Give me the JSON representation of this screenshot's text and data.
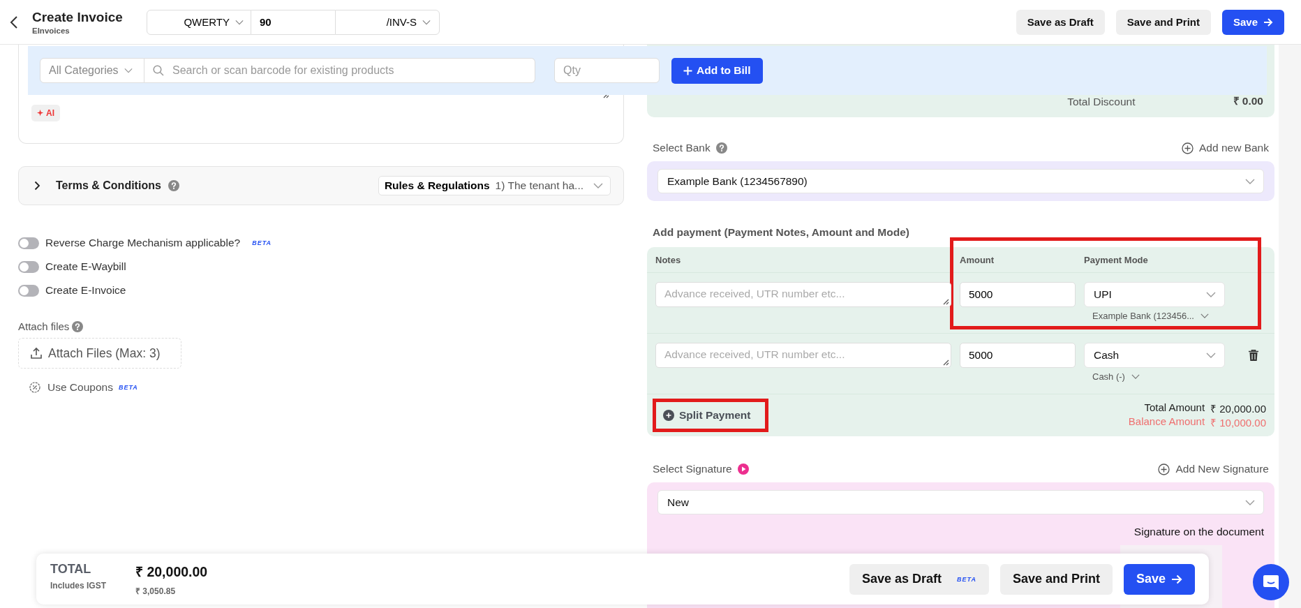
{
  "header": {
    "title": "Create Invoice",
    "subtitle": "EInvoices",
    "invoice_prefix": "QWERTY",
    "invoice_number": "90",
    "invoice_suffix": "/INV-S",
    "buttons": [
      {
        "label": "Save as Draft",
        "kind": "secondary"
      },
      {
        "label": "Save and Print",
        "kind": "secondary"
      },
      {
        "label": "Save",
        "kind": "primary"
      }
    ]
  },
  "product_bar": {
    "category": "All Categories",
    "search_placeholder": "Search or scan barcode for existing products",
    "qty_placeholder": "Qty",
    "add_button": "Add to Bill"
  },
  "notes_card": {
    "ai_badge": "AI"
  },
  "terms": {
    "title": "Terms & Conditions",
    "expanded": false,
    "select_label": "Rules & Regulations",
    "select_value": "1) The tenant ha..."
  },
  "toggles": [
    {
      "label": "Reverse Charge Mechanism applicable?",
      "on": false,
      "badge": "BETA"
    },
    {
      "label": "Create E-Waybill",
      "on": false
    },
    {
      "label": "Create E-Invoice",
      "on": false
    }
  ],
  "attach": {
    "label": "Attach files",
    "button": "Attach Files (Max: 3)"
  },
  "coupons": {
    "label": "Use Coupons",
    "badge": "BETA"
  },
  "discount": {
    "label": "Total Discount",
    "value": "₹ 0.00"
  },
  "bank": {
    "label": "Select Bank",
    "add": "Add new Bank",
    "value": "Example Bank (1234567890)"
  },
  "payment": {
    "title": "Add payment (Payment Notes, Amount and Mode)",
    "columns": [
      "Notes",
      "Amount",
      "Payment Mode"
    ],
    "rows": [
      {
        "notes_placeholder": "Advance received, UTR number etc...",
        "amount": "5000",
        "mode": "UPI",
        "account": "Example Bank (123456...",
        "deletable": false
      },
      {
        "notes_placeholder": "Advance received, UTR number etc...",
        "amount": "5000",
        "mode": "Cash",
        "account": "Cash (-)",
        "deletable": true
      }
    ],
    "split_button": "Split Payment",
    "total_label": "Total Amount",
    "total_value": "₹ 20,000.00",
    "balance_label": "Balance Amount",
    "balance_value": "₹ 10,000.00"
  },
  "signature": {
    "label": "Select Signature",
    "add": "Add New Signature",
    "value": "New",
    "caption": "Signature on the document"
  },
  "footer": {
    "total_label": "TOTAL",
    "total_value": "₹ 20,000.00",
    "tax_label": "Includes IGST",
    "tax_value": "₹ 3,050.85",
    "buttons": [
      {
        "label": "Save as Draft",
        "kind": "secondary",
        "badge": "BETA"
      },
      {
        "label": "Save and Print",
        "kind": "secondary"
      },
      {
        "label": "Save",
        "kind": "primary"
      }
    ]
  }
}
